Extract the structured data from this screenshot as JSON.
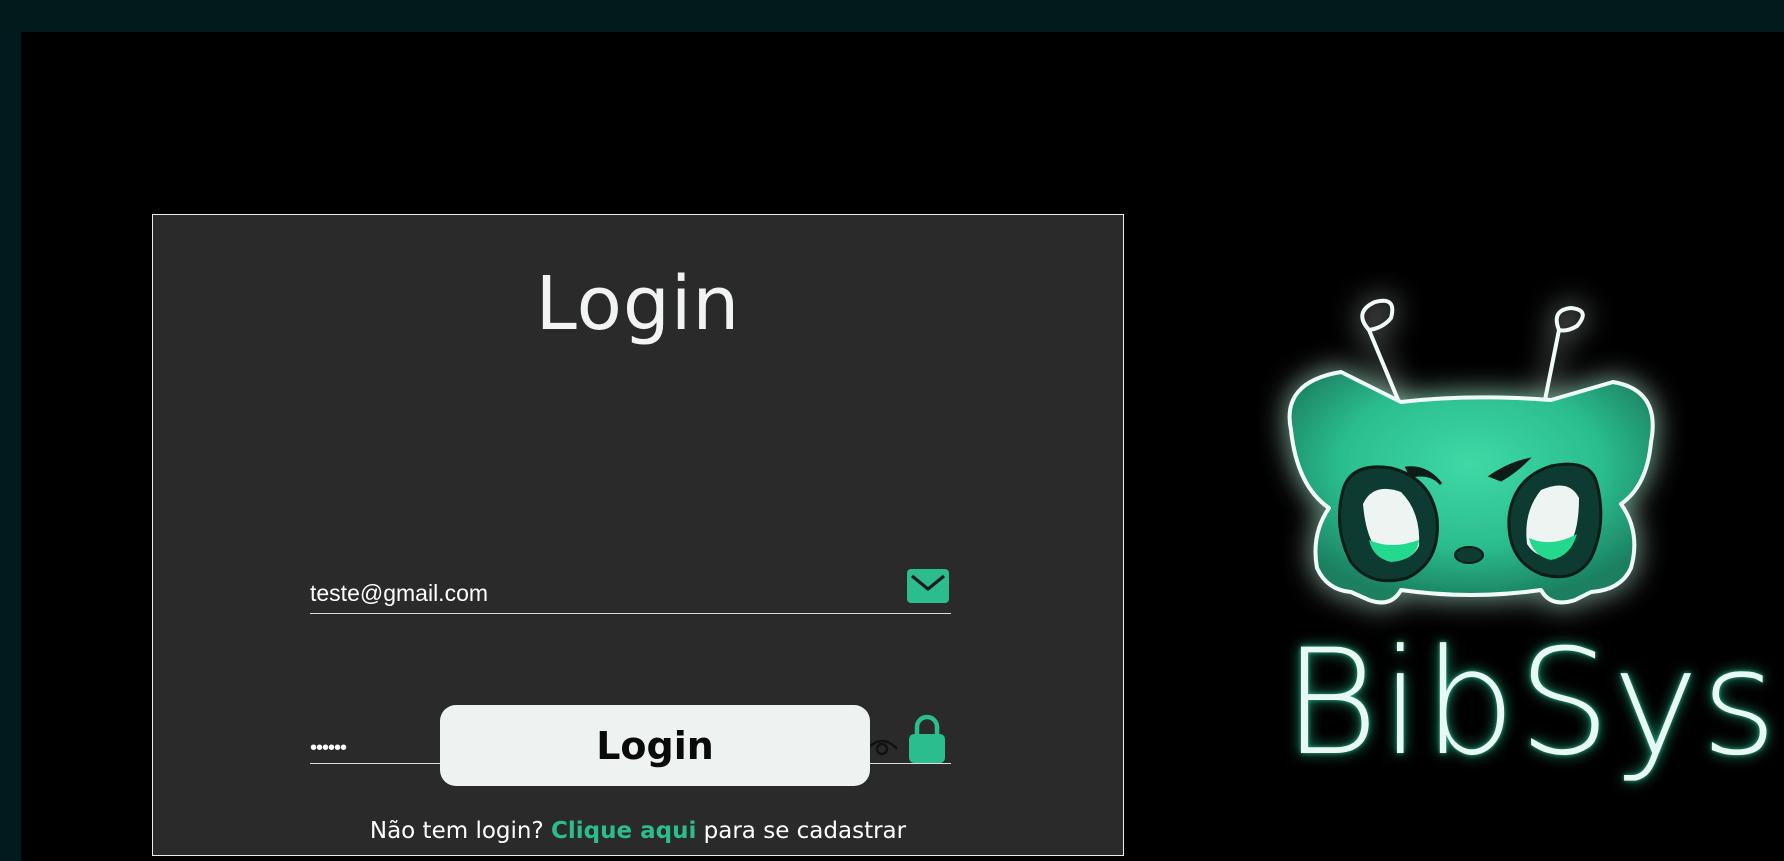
{
  "login": {
    "title": "Login",
    "email_value": "teste@gmail.com",
    "password_value": "••••••",
    "button_label": "Login",
    "signup_prefix": "Não tem login?",
    "signup_link": "Clique aqui",
    "signup_suffix": "para se cadastrar"
  },
  "brand": {
    "name": "BibSys"
  },
  "colors": {
    "accent": "#2bbd8e",
    "card_bg": "#2a2a2a",
    "page_bg": "#000000",
    "frame_bg": "#021a1c"
  },
  "icons": [
    "mail-icon",
    "eye-icon",
    "lock-icon",
    "alien-mascot-logo"
  ]
}
